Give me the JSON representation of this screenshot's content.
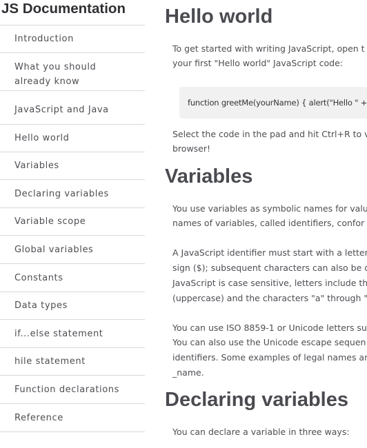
{
  "nav": {
    "header": "JS Documentation",
    "links": [
      "Introduction",
      "What you should already know",
      "JavaScript and Java",
      "Hello world",
      "Variables",
      "Declaring variables",
      "Variable scope",
      "Global variables",
      "Constants",
      "Data types",
      "if...else statement",
      "hile statement",
      "Function declarations",
      "Reference"
    ],
    "link_what_line1": "What you should",
    "link_what_line2": "already know"
  },
  "sections": {
    "hello": {
      "title": "Hello world",
      "p1_line1": "To get started with writing JavaScript, open t",
      "p1_line2": "your first \"Hello world\" JavaScript code:",
      "code": "function greetMe(yourName) { alert(\"Hello \" + you",
      "p2_line1": "Select the code in the pad and hit Ctrl+R to v",
      "p2_line2": "browser!"
    },
    "variables": {
      "title": "Variables",
      "p1_line1": "You use variables as symbolic names for valu",
      "p1_line2": "names of variables, called identifiers, confor",
      "p2_line1": "A JavaScript identifier must start with a letter",
      "p2_line2": "sign ($); subsequent characters can also be d",
      "p2_line3": "JavaScript is case sensitive, letters include the",
      "p2_line4": "(uppercase) and the characters \"a\" through \"",
      "p3_line1": "You can use ISO 8859-1 or Unicode letters su",
      "p3_line2": "You can also use the Unicode escape sequen",
      "p3_line3": "identifiers. Some examples of legal names ar",
      "p3_line4": "_name."
    },
    "declaring": {
      "title": "Declaring variables",
      "p1_line1": "You can declare a variable in three ways:"
    }
  }
}
